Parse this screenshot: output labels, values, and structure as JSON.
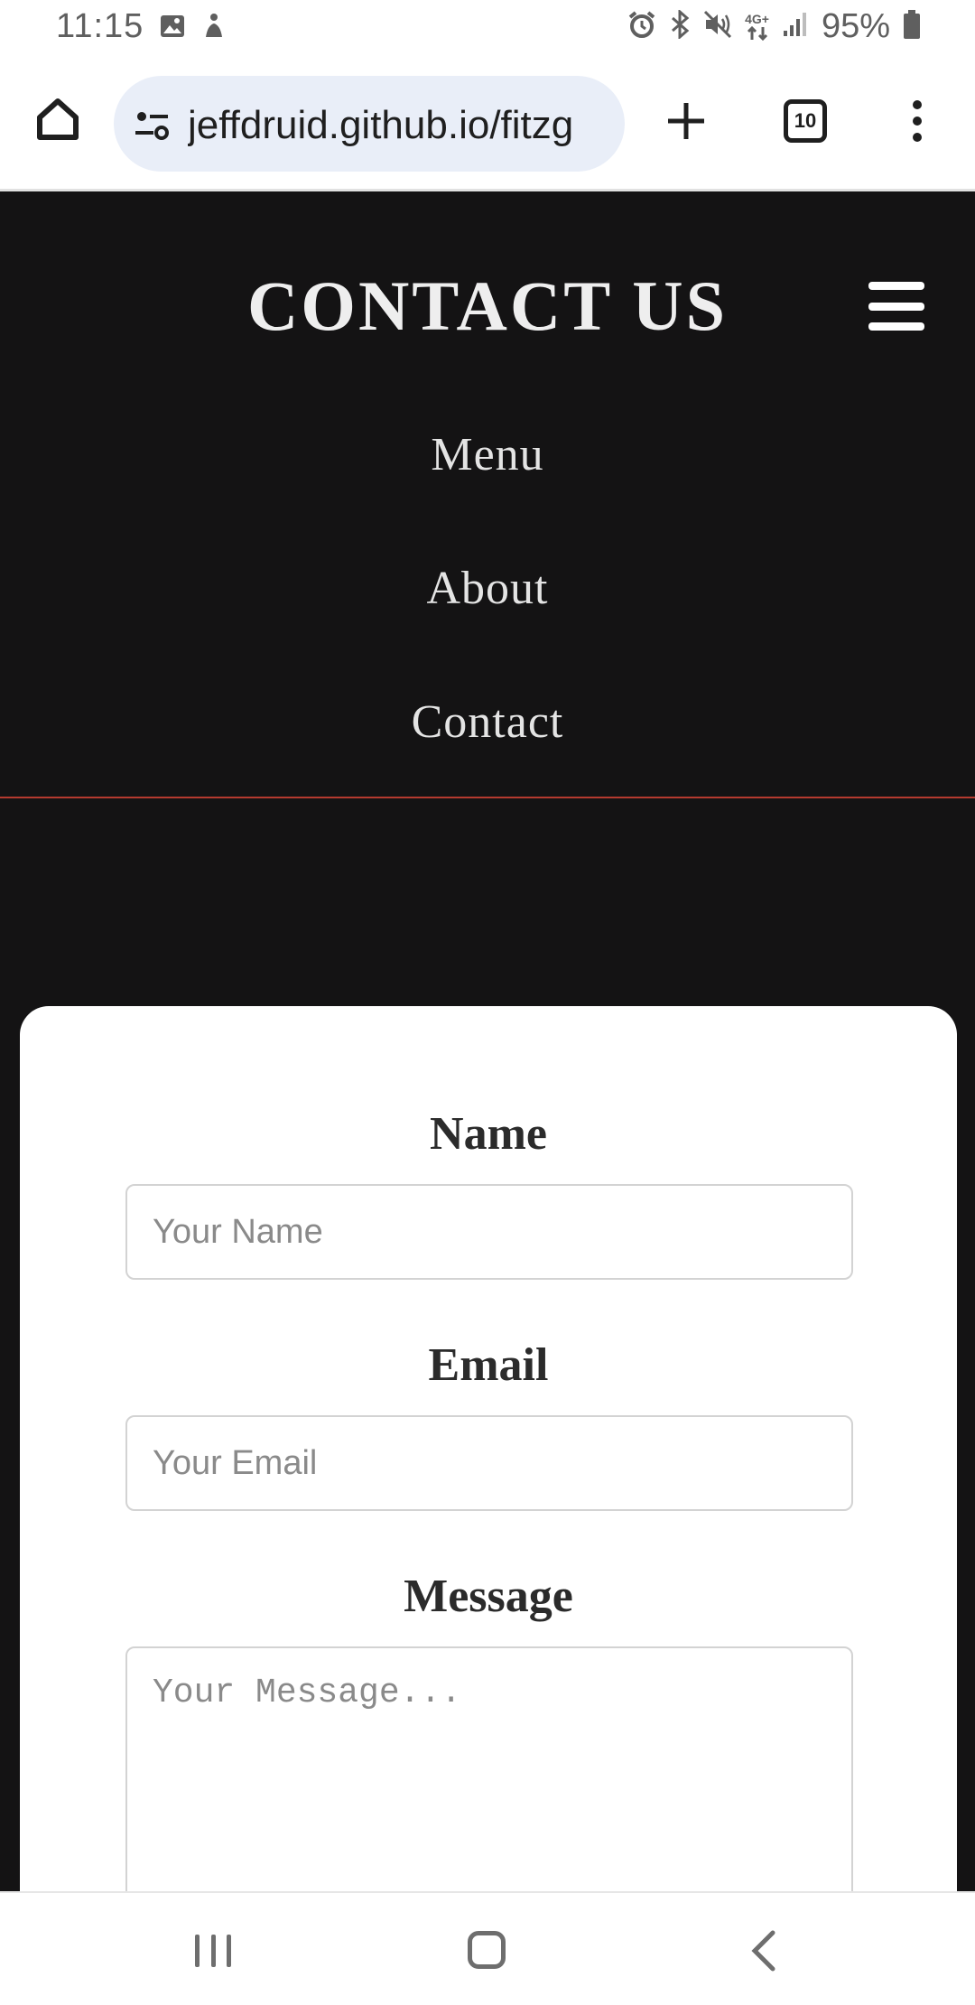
{
  "status_bar": {
    "time": "11:15",
    "network": "4G+",
    "battery": "95%",
    "left_icons": [
      "image-icon",
      "accessibility-icon"
    ],
    "right_icons": [
      "alarm-icon",
      "bluetooth-icon",
      "mute-icon",
      "network-icon",
      "signal-icon",
      "battery-icon"
    ]
  },
  "browser": {
    "url": "jeffdruid.github.io/fitzg",
    "tab_count": "10"
  },
  "header": {
    "title": "CONTACT US",
    "nav": [
      "Menu",
      "About",
      "Contact"
    ],
    "accent_color": "#b53a2f"
  },
  "form": {
    "name_label": "Name",
    "name_placeholder": "Your Name",
    "email_label": "Email",
    "email_placeholder": "Your Email",
    "message_label": "Message",
    "message_placeholder": "Your Message..."
  }
}
